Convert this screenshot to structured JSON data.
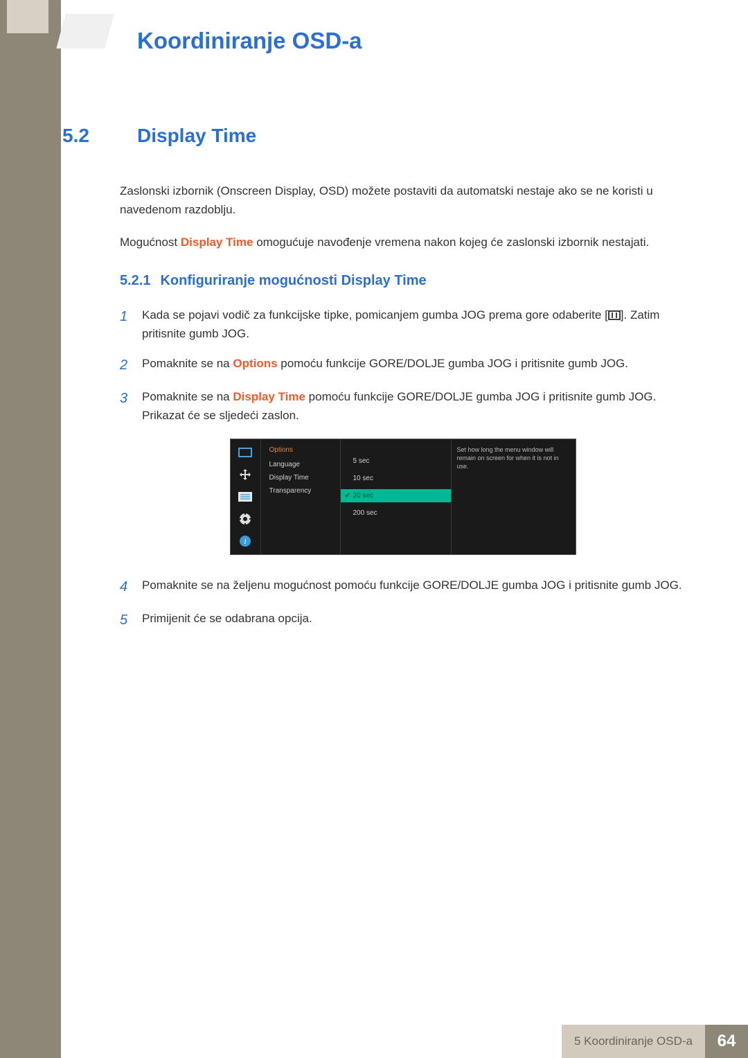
{
  "chapter_title": "Koordiniranje OSD-a",
  "section": {
    "num": "5.2",
    "title": "Display Time"
  },
  "intro_para1": "Zaslonski izbornik (Onscreen Display, OSD) možete postaviti da automatski nestaje ako se ne koristi u navedenom razdoblju.",
  "intro_para2_pre": "Mogućnost ",
  "intro_para2_h": "Display Time",
  "intro_para2_post": " omogućuje navođenje vremena nakon kojeg će zaslonski izbornik nestajati.",
  "subsection": {
    "num": "5.2.1",
    "title": "Konfiguriranje mogućnosti Display Time"
  },
  "steps": {
    "s1_a": "Kada se pojavi vodič za funkcijske tipke, pomicanjem gumba JOG prema gore odaberite [",
    "s1_b": "]. Zatim pritisnite gumb JOG.",
    "s2_a": "Pomaknite se na ",
    "s2_h": "Options",
    "s2_b": " pomoću funkcije GORE/DOLJE gumba JOG i pritisnite gumb JOG.",
    "s3_a": "Pomaknite se na ",
    "s3_h": "Display Time",
    "s3_b": " pomoću funkcije GORE/DOLJE gumba JOG i pritisnite gumb JOG. Prikazat će se sljedeći zaslon.",
    "s4": "Pomaknite se na željenu mogućnost pomoću funkcije GORE/DOLJE gumba JOG i pritisnite gumb JOG.",
    "s5": "Primijenit će se odabrana opcija."
  },
  "nums": {
    "n1": "1",
    "n2": "2",
    "n3": "3",
    "n4": "4",
    "n5": "5"
  },
  "osd": {
    "title": "Options",
    "menu": {
      "language": "Language",
      "display_time": "Display Time",
      "transparency": "Transparency"
    },
    "opts": {
      "o1": "5 sec",
      "o2": "10 sec",
      "o3": "20 sec",
      "o4": "200 sec"
    },
    "help": "Set how long the menu window will remain on screen for when it is not in use."
  },
  "footer": {
    "label": "5 Koordiniranje OSD-a",
    "page": "64"
  }
}
